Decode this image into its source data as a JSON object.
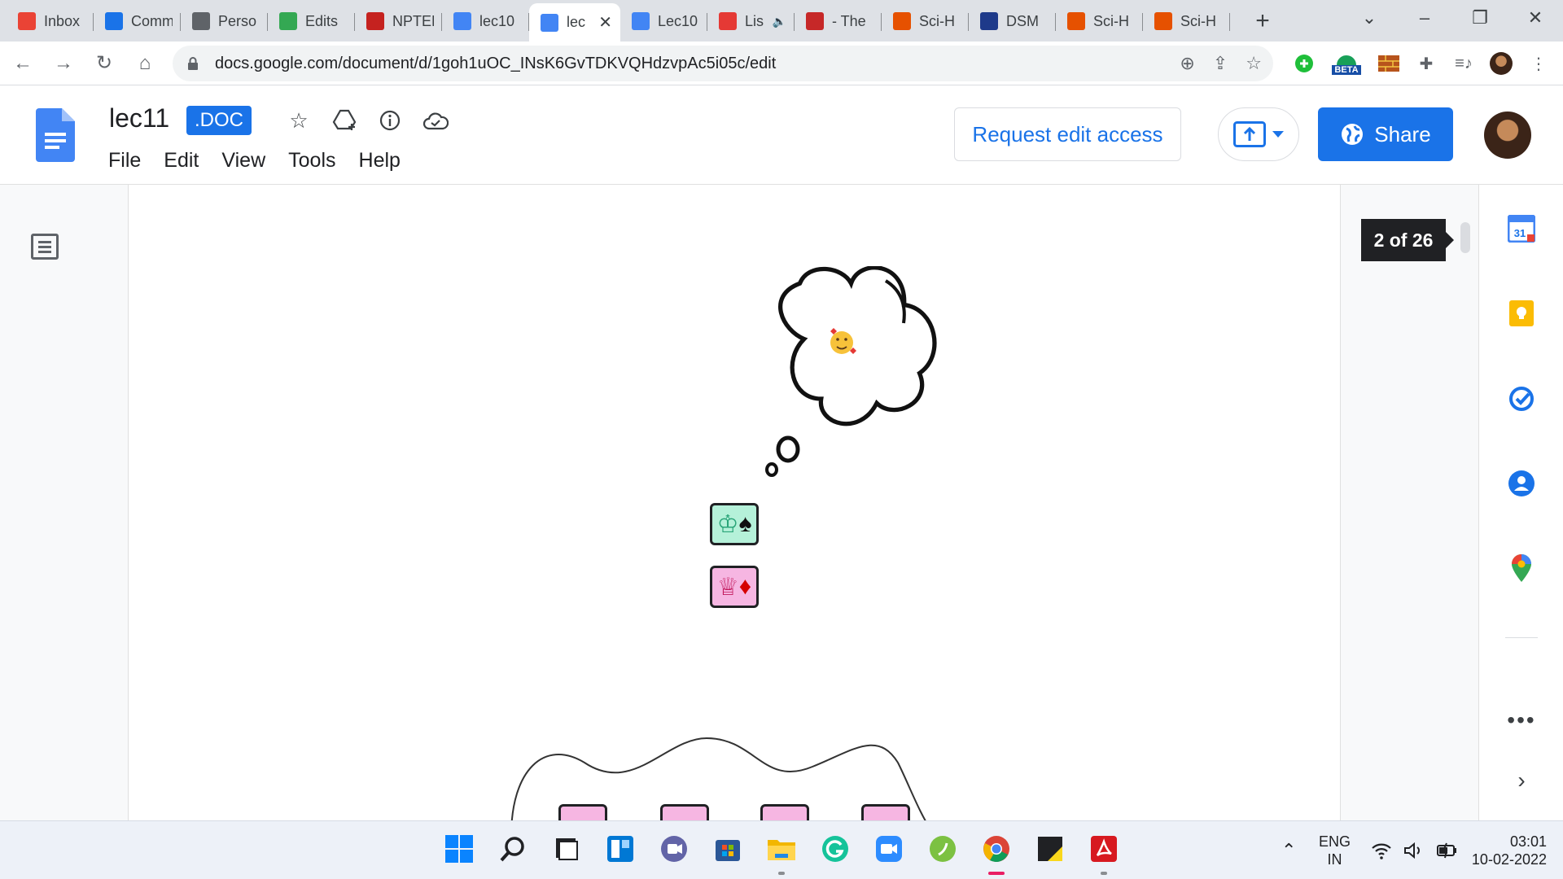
{
  "browser": {
    "tabs": [
      {
        "title": "Inbox",
        "favicon": "gmail-icon",
        "color": "#ea4335"
      },
      {
        "title": "Comm",
        "favicon": "link-icon",
        "color": "#1a73e8"
      },
      {
        "title": "Perso",
        "favicon": "dna-icon",
        "color": "#5f6368"
      },
      {
        "title": "Edits",
        "favicon": "drive-icon",
        "color": "#34a853"
      },
      {
        "title": "NPTEL",
        "favicon": "nptel-icon",
        "color": "#c5221f"
      },
      {
        "title": "lec10",
        "favicon": "docs-icon",
        "color": "#4285f4"
      },
      {
        "title": "lec",
        "favicon": "docs-icon",
        "color": "#4285f4",
        "active": true
      },
      {
        "title": "Lec10",
        "favicon": "docs-icon",
        "color": "#4285f4"
      },
      {
        "title": "Lis",
        "favicon": "g-icon",
        "color": "#e53935",
        "audio": true
      },
      {
        "title": "- The",
        "favicon": "a-icon",
        "color": "#c62828"
      },
      {
        "title": "Sci-H",
        "favicon": "scihub-icon",
        "color": "#e65100"
      },
      {
        "title": "DSM",
        "favicon": "dsm-icon",
        "color": "#1e3a8a"
      },
      {
        "title": "Sci-H",
        "favicon": "scihub-icon",
        "color": "#e65100"
      },
      {
        "title": "Sci-H",
        "favicon": "scihub-icon",
        "color": "#e65100"
      }
    ],
    "url": "docs.google.com/document/d/1goh1uOC_INsK6GvTDKVQHdzvpAc5i05c/edit",
    "ext_badge": "BETA"
  },
  "docs": {
    "title": "lec11",
    "badge": ".DOC",
    "menu": [
      "File",
      "Edit",
      "View",
      "Tools",
      "Help"
    ],
    "request_edit": "Request edit access",
    "share": "Share",
    "page_indicator": "2 of 26",
    "calendar_day": "31"
  },
  "taskbar": {
    "language": "ENG",
    "region": "IN",
    "time": "03:01",
    "date": "10-02-2022"
  },
  "colors": {
    "accent": "#1a73e8",
    "card_green": "#b5f1d9",
    "card_pink": "#f6b6e2"
  }
}
